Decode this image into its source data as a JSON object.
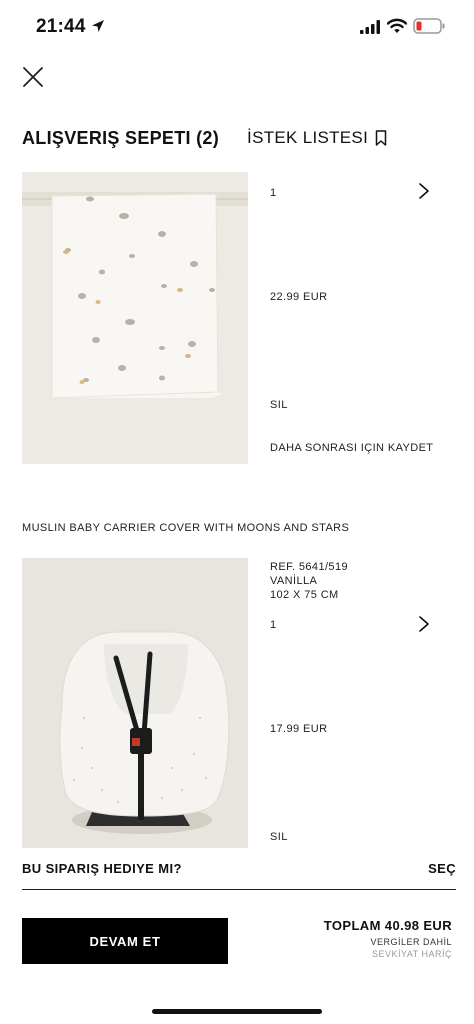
{
  "status_bar": {
    "time": "21:44"
  },
  "tabs": {
    "cart": "ALIŞVERIŞ SEPETI (2)",
    "wishlist": "İSTEK LISTESI"
  },
  "items": [
    {
      "quantity": "1",
      "price": "22.99 EUR",
      "remove": "SIL",
      "save_later": "DAHA SONRASI IÇIN KAYDET"
    },
    {
      "title": "MUSLIN BABY CARRIER COVER WITH MOONS AND STARS",
      "ref": "REF. 5641/519",
      "color": "VANİLLA",
      "size": "102 X 75 CM",
      "quantity": "1",
      "price": "17.99 EUR",
      "remove": "SIL"
    }
  ],
  "gift": {
    "question": "BU SIPARIŞ HEDIYE MI?",
    "select": "SEÇ"
  },
  "checkout": {
    "button": "DEVAM ET",
    "total": "TOPLAM 40.98 EUR",
    "vat": "VERGİLER DAHİL",
    "shipping": "SEVKİYAT HARİÇ"
  }
}
